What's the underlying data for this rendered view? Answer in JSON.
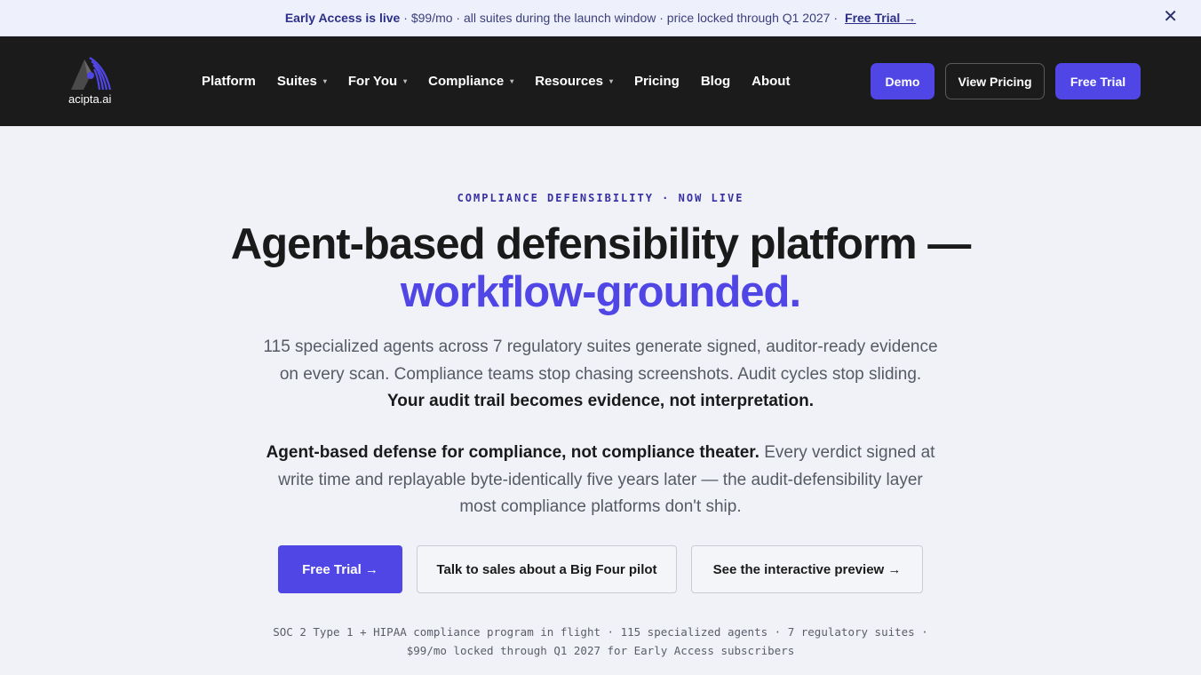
{
  "announcement": {
    "headline": "Early Access is live",
    "message": "· $99/mo · all suites during the launch window · price locked through Q1 2027 ·",
    "link": "Free Trial →",
    "close_icon": "close-icon"
  },
  "nav": {
    "logo_text": "acipta.ai",
    "items": [
      {
        "label": "Platform",
        "has_dropdown": false
      },
      {
        "label": "Suites",
        "has_dropdown": true
      },
      {
        "label": "For You",
        "has_dropdown": true
      },
      {
        "label": "Compliance",
        "has_dropdown": true
      },
      {
        "label": "Resources",
        "has_dropdown": true
      },
      {
        "label": "Pricing",
        "has_dropdown": false
      },
      {
        "label": "Blog",
        "has_dropdown": false
      },
      {
        "label": "About",
        "has_dropdown": false
      }
    ],
    "caret": "▾",
    "buttons": {
      "demo": "Demo",
      "view_pricing": "View Pricing",
      "free_trial": "Free Trial"
    }
  },
  "hero": {
    "eyebrow": "COMPLIANCE DEFENSIBILITY · NOW LIVE",
    "headline": "Agent-based defensibility platform —",
    "headline_accent": "workflow-grounded.",
    "sub1_text": "115 specialized agents across 7 regulatory suites generate signed, auditor-ready evidence on every scan. Compliance teams stop chasing screenshots. Audit cycles stop sliding. ",
    "sub1_bold": "Your audit trail becomes evidence, not interpretation.",
    "sub2_bold": "Agent-based defense for compliance, not compliance theater.",
    "sub2_text": " Every verdict signed at write time and replayable byte-identically five years later — the audit-defensibility layer most compliance platforms don't ship.",
    "cta": {
      "trial": "Free Trial →",
      "sales": "Talk to sales about a Big Four pilot",
      "preview": "See the interactive preview →"
    },
    "footnote": "SOC 2 Type 1 + HIPAA compliance program in flight · 115 specialized agents · 7 regulatory suites · $99/mo locked through Q1 2027 for Early Access subscribers"
  },
  "colors": {
    "accent": "#4f46e5",
    "nav_background": "#1b1b1b",
    "announcement_background": "#eef0fb",
    "page_background": "#f0f2f7"
  }
}
